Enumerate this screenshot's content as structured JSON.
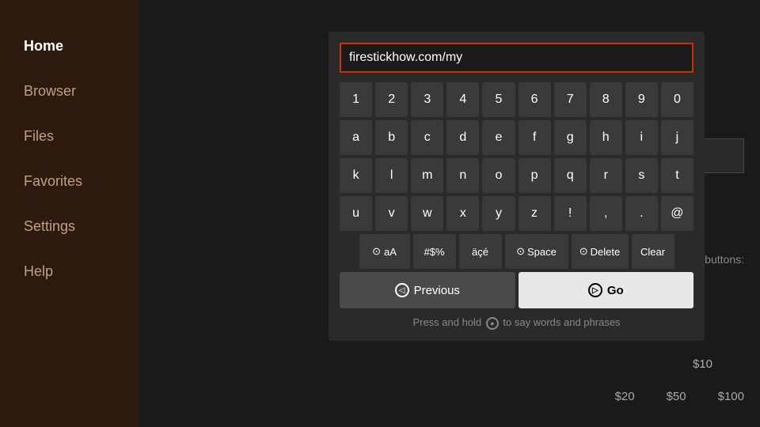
{
  "sidebar": {
    "items": [
      {
        "id": "home",
        "label": "Home",
        "active": true
      },
      {
        "id": "browser",
        "label": "Browser",
        "active": false
      },
      {
        "id": "files",
        "label": "Files",
        "active": false
      },
      {
        "id": "favorites",
        "label": "Favorites",
        "active": false
      },
      {
        "id": "settings",
        "label": "Settings",
        "active": false
      },
      {
        "id": "help",
        "label": "Help",
        "active": false
      }
    ]
  },
  "keyboard": {
    "url_value": "firestickhow.com/my",
    "url_placeholder": "",
    "rows": {
      "numbers": [
        "1",
        "2",
        "3",
        "4",
        "5",
        "6",
        "7",
        "8",
        "9",
        "0"
      ],
      "row1": [
        "a",
        "b",
        "c",
        "d",
        "e",
        "f",
        "g",
        "h",
        "i",
        "j"
      ],
      "row2": [
        "k",
        "l",
        "m",
        "n",
        "o",
        "p",
        "q",
        "r",
        "s",
        "t"
      ],
      "row3": [
        "u",
        "v",
        "w",
        "x",
        "y",
        "z",
        "!",
        ",",
        ".",
        "@"
      ]
    },
    "special_keys": {
      "case": "aA",
      "symbols": "#$%",
      "accents": "äçé",
      "space": "Space",
      "delete": "Delete",
      "clear": "Clear"
    },
    "buttons": {
      "previous": "Previous",
      "go": "Go"
    },
    "voice_hint": "Press and hold",
    "voice_hint_suffix": "to say words and phrases"
  },
  "donation": {
    "label": "ase donation buttons:",
    "label2": ")",
    "amount1": "$10",
    "amount2": "$20",
    "amount3": "$50",
    "amount4": "$100"
  }
}
